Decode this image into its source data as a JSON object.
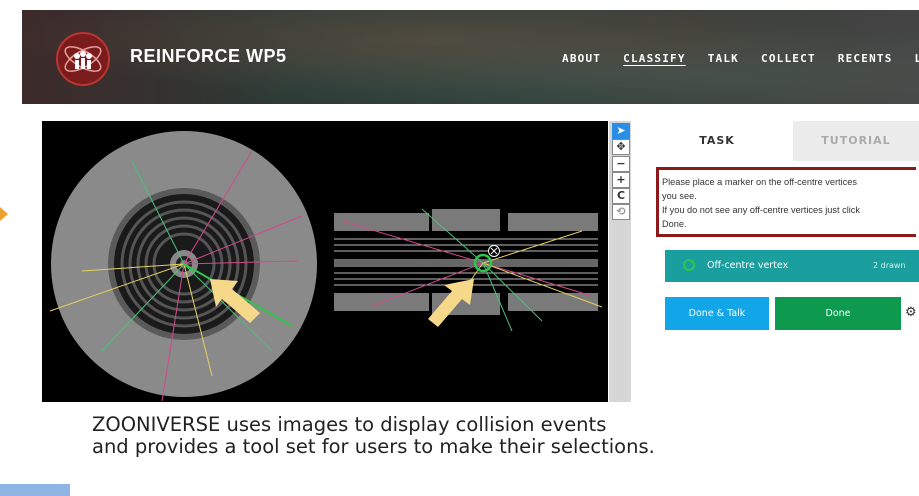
{
  "header": {
    "brand": "REINFORCE WP5",
    "nav": [
      "ABOUT",
      "CLASSIFY",
      "TALK",
      "COLLECT",
      "RECENTS",
      "L"
    ],
    "active_nav": "CLASSIFY"
  },
  "viewer_toolbar": {
    "icons": [
      "pointer-icon",
      "pan-icon",
      "zoom-out-icon",
      "zoom-in-icon",
      "reset-icon",
      "rotate-icon"
    ],
    "labels": {
      "zoom_out": "−",
      "zoom_in": "+",
      "reset": "C",
      "rotate": "⟲",
      "pointer": "➤",
      "pan": "✥"
    }
  },
  "task_panel": {
    "tabs": {
      "task": "TASK",
      "tutorial": "TUTORIAL"
    },
    "instruction": {
      "line1": "Please place a marker on the off-centre vertices",
      "line2": "you see.",
      "line3": "If you do not see any off-centre vertices just click",
      "line4": "Done."
    },
    "tool": {
      "label": "Off-centre vertex",
      "count": "2 drawn"
    },
    "buttons": {
      "done_talk": "Done & Talk",
      "done": "Done",
      "settings": "⚙"
    }
  },
  "caption": {
    "line1": "ZOONIVERSE uses images to display collision events",
    "line2": "and provides a tool set for users to make their selections."
  },
  "colors": {
    "highlight_border": "#8b1a1a",
    "tool_teal": "#1b9e9e",
    "done_talk_blue": "#12a6e8",
    "done_green": "#0d9a4f",
    "marker_green": "#2ec64a",
    "arrow_yellow": "#f5d88a"
  }
}
